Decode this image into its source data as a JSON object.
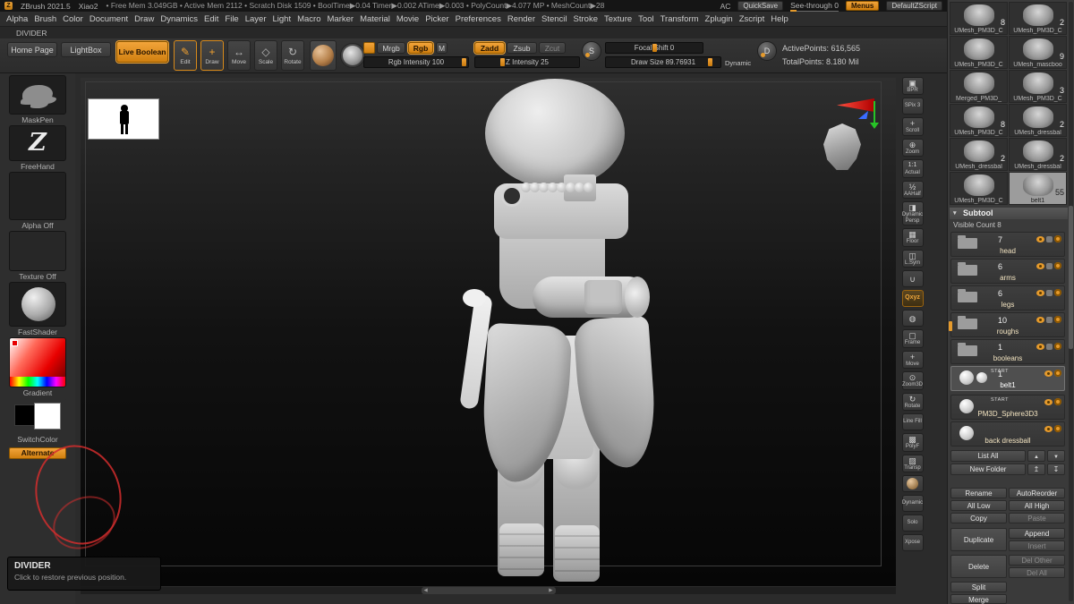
{
  "titlebar": {
    "logo": "Z",
    "app": "ZBrush 2021.5",
    "doc": "Xiao2",
    "stats": "• Free Mem 3.049GB  • Active Mem 2112  • Scratch Disk 1509  • BoolTime▶0.04 Timer▶0.002 ATime▶0.003  • PolyCount▶4.077 MP  • MeshCount▶28",
    "ac": "AC",
    "quicksave": "QuickSave",
    "see_through": "See-through 0",
    "menus": "Menus",
    "zscript": "DefaultZScript"
  },
  "menubar": {
    "items": [
      "Alpha",
      "Brush",
      "Color",
      "Document",
      "Draw",
      "Dynamics",
      "Edit",
      "File",
      "Layer",
      "Light",
      "Macro",
      "Marker",
      "Material",
      "Movie",
      "Picker",
      "Preferences",
      "Render",
      "Stencil",
      "Stroke",
      "Texture",
      "Tool",
      "Transform",
      "Zplugin",
      "Zscript",
      "Help"
    ]
  },
  "divider_label": "DIVIDER",
  "toolbar": {
    "home_page": "Home Page",
    "lightbox": "LightBox",
    "live_boolean": "Live Boolean",
    "edit": "Edit",
    "draw": "Draw",
    "move": "Move",
    "scale": "Scale",
    "rotate": "Rotate",
    "mrgb": "Mrgb",
    "rgb": "Rgb",
    "m": "M",
    "rgb_intensity": "Rgb Intensity 100",
    "zadd": "Zadd",
    "zsub": "Zsub",
    "zcut": "Zcut",
    "z_intensity": "Z Intensity 25",
    "focal_shift": "Focal Shift 0",
    "draw_size": "Draw Size 89.76931",
    "dynamic": "Dynamic",
    "active_points": "ActivePoints: 616,565",
    "total_points": "TotalPoints: 8.180 Mil"
  },
  "left_sidebar": {
    "items": [
      {
        "label": "MaskPen"
      },
      {
        "label": "FreeHand"
      },
      {
        "label": "Alpha Off"
      },
      {
        "label": "Texture Off"
      },
      {
        "label": "FastShader"
      },
      {
        "label": "Gradient"
      },
      {
        "label": "SwitchColor"
      },
      {
        "label": "Alternate"
      }
    ]
  },
  "right_strip": {
    "items": [
      {
        "icon": "▣",
        "label": "BPR"
      },
      {
        "icon": "",
        "label": "SPix 3"
      },
      {
        "icon": "+",
        "label": "Scroll"
      },
      {
        "icon": "⊕",
        "label": "Zoom"
      },
      {
        "icon": "1:1",
        "label": "Actual"
      },
      {
        "icon": "½",
        "label": "AAHalf"
      },
      {
        "icon": "◨",
        "label": "Dynamic Persp"
      },
      {
        "icon": "▦",
        "label": "Floor"
      },
      {
        "icon": "◫",
        "label": "L.Sym"
      },
      {
        "icon": "∪",
        "label": ""
      },
      {
        "icon": "",
        "label": "Qxyz"
      },
      {
        "icon": "◍",
        "label": ""
      },
      {
        "icon": "▢",
        "label": "Frame"
      },
      {
        "icon": "+",
        "label": "Move"
      },
      {
        "icon": "⊙",
        "label": "Zoom3D"
      },
      {
        "icon": "↻",
        "label": "Rotate"
      },
      {
        "icon": "",
        "label": "Line Fill"
      },
      {
        "icon": "▩",
        "label": "PolyF"
      },
      {
        "icon": "▨",
        "label": "Transp"
      },
      {
        "icon": "",
        "label": ""
      },
      {
        "icon": "",
        "label": "Dynamic"
      },
      {
        "icon": "",
        "label": "Solo"
      },
      {
        "icon": "",
        "label": "Xpose"
      }
    ]
  },
  "tool_palette": {
    "cells": [
      {
        "name": "UMesh_PM3D_C",
        "count": "8"
      },
      {
        "name": "UMesh_PM3D_C",
        "count": "2"
      },
      {
        "name": "UMesh_PM3D_C",
        "count": ""
      },
      {
        "name": "UMesh_mascboo",
        "count": "9"
      },
      {
        "name": "Merged_PM3D_",
        "count": ""
      },
      {
        "name": "UMesh_PM3D_C",
        "count": "3"
      },
      {
        "name": "UMesh_PM3D_C",
        "count": "8"
      },
      {
        "name": "UMesh_dressbal",
        "count": "2"
      },
      {
        "name": "UMesh_dressbal",
        "count": "2"
      },
      {
        "name": "UMesh_dressbal",
        "count": "2"
      },
      {
        "name": "UMesh_PM3D_C",
        "count": ""
      },
      {
        "name": "belt1",
        "count": "55"
      }
    ]
  },
  "subtool": {
    "title": "Subtool",
    "visible_count": "Visible Count 8",
    "items": [
      {
        "name": "head",
        "count": "7",
        "badge": ""
      },
      {
        "name": "arms",
        "count": "6",
        "badge": ""
      },
      {
        "name": "legs",
        "count": "6",
        "badge": ""
      },
      {
        "name": "roughs",
        "count": "10",
        "badge": ""
      },
      {
        "name": "booleans",
        "count": "1",
        "badge": ""
      },
      {
        "name": "belt1",
        "count": "1",
        "badge": "START"
      },
      {
        "name": "PM3D_Sphere3D3",
        "count": "",
        "badge": "START"
      },
      {
        "name": "back dressball",
        "count": "",
        "badge": ""
      }
    ],
    "list_all": "List All",
    "new_folder": "New Folder",
    "actions": {
      "rename": "Rename",
      "autoreorder": "AutoReorder",
      "all_low": "All Low",
      "all_high": "All High",
      "copy": "Copy",
      "paste": "Paste",
      "duplicate": "Duplicate",
      "append": "Append",
      "insert": "Insert",
      "delete": "Delete",
      "del_other": "Del Other",
      "del_all": "Del All",
      "split": "Split",
      "merge": "Merge"
    }
  },
  "tooltip": {
    "title": "DIVIDER",
    "text": "Click to restore previous position."
  }
}
